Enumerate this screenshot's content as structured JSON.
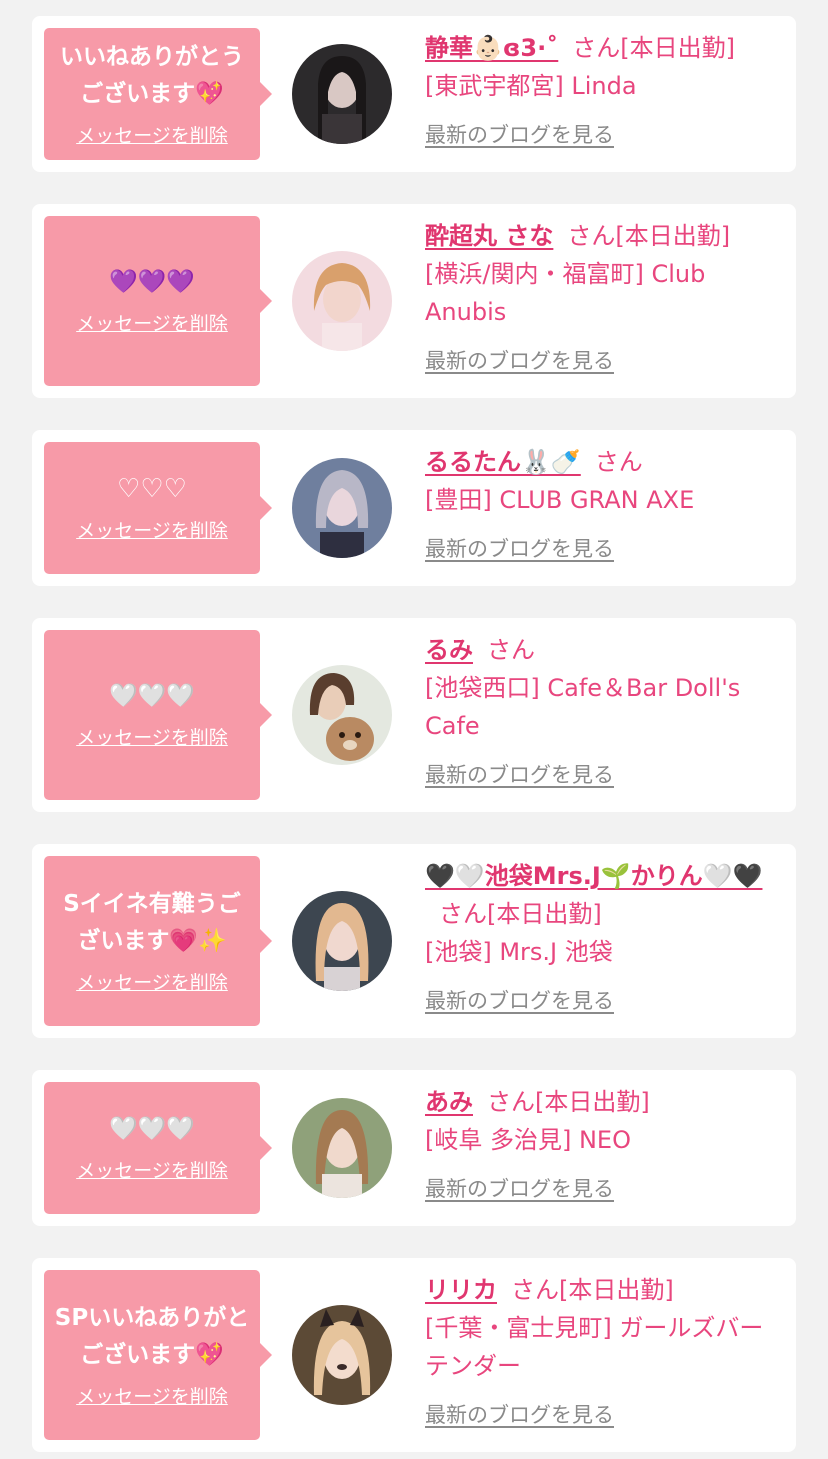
{
  "labels": {
    "delete_message": "メッセージを削除",
    "latest_blog": "最新のブログを見る",
    "san": "さん"
  },
  "colors": {
    "bubble": "#f79aa8",
    "name": "#e0366f",
    "text": "#e8467e",
    "link_gray": "#8a8a8a"
  },
  "items": [
    {
      "message": "いいねありがとうございます💖",
      "name": "静華👶🏻ɞ3⋅˚",
      "status": "[本日出勤]",
      "shop": "[東武宇都宮] Linda"
    },
    {
      "message": "💜💜💜",
      "name": "酔超丸 さな",
      "status": "[本日出勤]",
      "shop": "[横浜/関内・福富町] Club Anubis"
    },
    {
      "message": "♡♡♡",
      "name": "るるたん🐰🍼",
      "status": "",
      "shop": "[豊田] CLUB GRAN AXE"
    },
    {
      "message": "🤍🤍🤍",
      "name": "るみ",
      "status": "",
      "shop": "[池袋西口] Cafe＆Bar Doll's Cafe"
    },
    {
      "message": "Sイイネ有難うございます💗✨",
      "name": "🖤🤍池袋Mrs.J🌱かりん🤍🖤",
      "status": "[本日出勤]",
      "shop": "[池袋] Mrs.J 池袋"
    },
    {
      "message": "🤍🤍🤍",
      "name": "あみ",
      "status": "[本日出勤]",
      "shop": "[岐阜 多治見] NEO"
    },
    {
      "message": "SPいいねありがとございます💖",
      "name": "リリカ",
      "status": "[本日出勤]",
      "shop": "[千葉・富士見町] ガールズバー テンダー"
    }
  ]
}
